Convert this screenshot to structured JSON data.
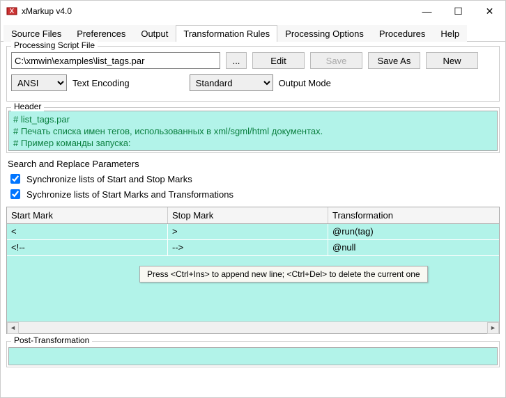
{
  "window": {
    "title": "xMarkup v4.0"
  },
  "tabs": [
    "Source Files",
    "Preferences",
    "Output",
    "Transformation Rules",
    "Processing Options",
    "Procedures",
    "Help"
  ],
  "activeTab": 3,
  "scriptFile": {
    "legend": "Processing Script File",
    "path": "C:\\xmwin\\examples\\list_tags.par",
    "browse": "...",
    "edit": "Edit",
    "save": "Save",
    "saveAs": "Save As",
    "new": "New",
    "encoding": "ANSI",
    "encodingLabel": "Text Encoding",
    "outputMode": "Standard",
    "outputModeLabel": "Output Mode"
  },
  "header": {
    "legend": "Header",
    "lines": [
      "# list_tags.par",
      "# Печать списка имен тегов, использованных в xml/sgml/html документах.",
      "# Пример команды запуска:"
    ]
  },
  "search": {
    "label": "Search and Replace Parameters",
    "cb1": "Synchronize lists of Start and Stop Marks",
    "cb2": "Sychronize lists of Start Marks and Transformations"
  },
  "table": {
    "cols": [
      "Start Mark",
      "Stop Mark",
      "Transformation"
    ],
    "rows": [
      [
        "<",
        ">",
        "@run(tag)"
      ],
      [
        "<!--",
        "-->",
        "@null"
      ]
    ],
    "tooltip": "Press <Ctrl+Ins> to append new line; <Ctrl+Del> to delete the current one"
  },
  "post": {
    "legend": "Post-Transformation"
  }
}
